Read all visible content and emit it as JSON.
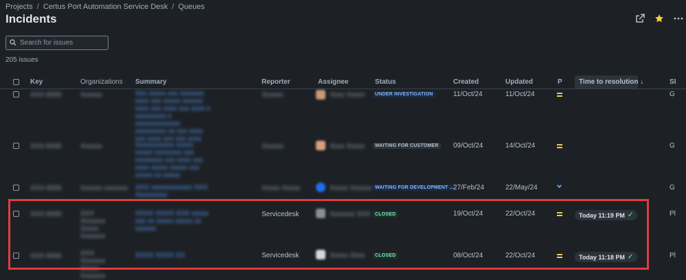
{
  "breadcrumb": [
    "Projects",
    "Certus Port Automation Service Desk",
    "Queues"
  ],
  "page": {
    "title": "Incidents"
  },
  "search": {
    "placeholder": "Search for issues"
  },
  "issue_count": "205 issues",
  "columns": {
    "key": "Key",
    "organizations": "Organizations",
    "summary": "Summary",
    "reporter": "Reporter",
    "assignee": "Assignee",
    "status": "Status",
    "created": "Created",
    "updated": "Updated",
    "priority": "P",
    "time_to_resolution": "Time to resolution ↓",
    "sla": "SI"
  },
  "icons": {
    "share": "share-icon",
    "star": "star-icon",
    "more": "more-icon",
    "search": "search-icon"
  },
  "colors": {
    "background": "#1d2125",
    "link": "#579dff",
    "star": "#f5cd47",
    "priority_medium": "#f5cd47",
    "highlight": "#e03d3d",
    "closed": "#7ee2b8"
  },
  "rows": [
    {
      "reporter": "",
      "status": "UNDER INVESTIGATION",
      "created": "11/Oct/24",
      "updated": "11/Oct/24",
      "priority": "medium",
      "time_to_resolution": "",
      "sla": "G"
    },
    {
      "reporter": "",
      "status": "WAITING FOR CUSTOMER",
      "created": "09/Oct/24",
      "updated": "14/Oct/24",
      "priority": "medium",
      "time_to_resolution": "",
      "sla": "G"
    },
    {
      "reporter": "",
      "status": "WAITING FOR DEVELOPMENT ...",
      "created": "27/Feb/24",
      "updated": "22/May/24",
      "priority": "low",
      "time_to_resolution": "",
      "sla": "G"
    },
    {
      "reporter": "Servicedesk",
      "status": "CLOSED",
      "created": "19/Oct/24",
      "updated": "22/Oct/24",
      "priority": "medium",
      "time_to_resolution": "Today 11:19 PM",
      "sla": "Pl"
    },
    {
      "reporter": "Servicedesk",
      "status": "CLOSED",
      "created": "08/Oct/24",
      "updated": "22/Oct/24",
      "priority": "medium",
      "time_to_resolution": "Today 11:18 PM",
      "sla": "Pl"
    }
  ]
}
